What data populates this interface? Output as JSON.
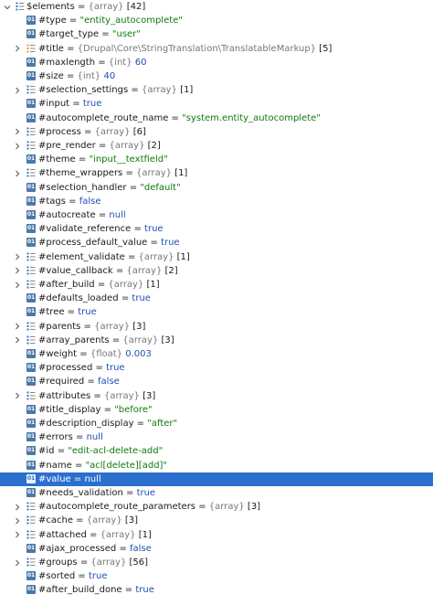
{
  "colors": {
    "selected_bg": "#2b6fcf",
    "string": "#117a0d",
    "keyword": "#1f4fb3",
    "type": "#777777"
  },
  "root": {
    "label": "$elements",
    "type": "{array}",
    "count": "[42]",
    "expanded": true
  },
  "rows": [
    {
      "kind": "prop",
      "key": "#type",
      "eq": " = ",
      "value": "\"entity_autocomplete\"",
      "vclass": "str"
    },
    {
      "kind": "prop",
      "key": "#target_type",
      "eq": " = ",
      "value": "\"user\"",
      "vclass": "str"
    },
    {
      "kind": "array",
      "key": "#title",
      "eq": " = ",
      "type": "{Drupal\\Core\\StringTranslation\\TranslatableMarkup}",
      "count": "[5]"
    },
    {
      "kind": "prop",
      "key": "#maxlength",
      "eq": " = ",
      "type": "{int}",
      "value": "60",
      "vclass": "num"
    },
    {
      "kind": "prop",
      "key": "#size",
      "eq": " = ",
      "type": "{int}",
      "value": "40",
      "vclass": "num"
    },
    {
      "kind": "array",
      "key": "#selection_settings",
      "eq": " = ",
      "type": "{array}",
      "count": "[1]"
    },
    {
      "kind": "prop",
      "key": "#input",
      "eq": " = ",
      "value": "true",
      "vclass": "kw"
    },
    {
      "kind": "prop",
      "key": "#autocomplete_route_name",
      "eq": " = ",
      "value": "\"system.entity_autocomplete\"",
      "vclass": "str"
    },
    {
      "kind": "array",
      "key": "#process",
      "eq": " = ",
      "type": "{array}",
      "count": "[6]"
    },
    {
      "kind": "array",
      "key": "#pre_render",
      "eq": " = ",
      "type": "{array}",
      "count": "[2]"
    },
    {
      "kind": "prop",
      "key": "#theme",
      "eq": " = ",
      "value": "\"input__textfield\"",
      "vclass": "str"
    },
    {
      "kind": "array",
      "key": "#theme_wrappers",
      "eq": " = ",
      "type": "{array}",
      "count": "[1]"
    },
    {
      "kind": "prop",
      "key": "#selection_handler",
      "eq": " = ",
      "value": "\"default\"",
      "vclass": "str"
    },
    {
      "kind": "prop",
      "key": "#tags",
      "eq": " = ",
      "value": "false",
      "vclass": "kw"
    },
    {
      "kind": "prop",
      "key": "#autocreate",
      "eq": " = ",
      "value": "null",
      "vclass": "kw"
    },
    {
      "kind": "prop",
      "key": "#validate_reference",
      "eq": " = ",
      "value": "true",
      "vclass": "kw"
    },
    {
      "kind": "prop",
      "key": "#process_default_value",
      "eq": " = ",
      "value": "true",
      "vclass": "kw"
    },
    {
      "kind": "array",
      "key": "#element_validate",
      "eq": " = ",
      "type": "{array}",
      "count": "[1]"
    },
    {
      "kind": "array",
      "key": "#value_callback",
      "eq": " = ",
      "type": "{array}",
      "count": "[2]"
    },
    {
      "kind": "array",
      "key": "#after_build",
      "eq": " = ",
      "type": "{array}",
      "count": "[1]"
    },
    {
      "kind": "prop",
      "key": "#defaults_loaded",
      "eq": " = ",
      "value": "true",
      "vclass": "kw"
    },
    {
      "kind": "prop",
      "key": "#tree",
      "eq": " = ",
      "value": "true",
      "vclass": "kw"
    },
    {
      "kind": "array",
      "key": "#parents",
      "eq": " = ",
      "type": "{array}",
      "count": "[3]"
    },
    {
      "kind": "array",
      "key": "#array_parents",
      "eq": " = ",
      "type": "{array}",
      "count": "[3]"
    },
    {
      "kind": "prop",
      "key": "#weight",
      "eq": " = ",
      "type": "{float}",
      "value": "0.003",
      "vclass": "num"
    },
    {
      "kind": "prop",
      "key": "#processed",
      "eq": " = ",
      "value": "true",
      "vclass": "kw"
    },
    {
      "kind": "prop",
      "key": "#required",
      "eq": " = ",
      "value": "false",
      "vclass": "kw"
    },
    {
      "kind": "array",
      "key": "#attributes",
      "eq": " = ",
      "type": "{array}",
      "count": "[3]"
    },
    {
      "kind": "prop",
      "key": "#title_display",
      "eq": " = ",
      "value": "\"before\"",
      "vclass": "str"
    },
    {
      "kind": "prop",
      "key": "#description_display",
      "eq": " = ",
      "value": "\"after\"",
      "vclass": "str"
    },
    {
      "kind": "prop",
      "key": "#errors",
      "eq": " = ",
      "value": "null",
      "vclass": "kw"
    },
    {
      "kind": "prop",
      "key": "#id",
      "eq": " = ",
      "value": "\"edit-acl-delete-add\"",
      "vclass": "str"
    },
    {
      "kind": "prop",
      "key": "#name",
      "eq": " = ",
      "value": "\"acl[delete][add]\"",
      "vclass": "str"
    },
    {
      "kind": "prop",
      "key": "#value",
      "eq": " = ",
      "value": "null",
      "vclass": "kw",
      "selected": true
    },
    {
      "kind": "prop",
      "key": "#needs_validation",
      "eq": " = ",
      "value": "true",
      "vclass": "kw"
    },
    {
      "kind": "array",
      "key": "#autocomplete_route_parameters",
      "eq": " = ",
      "type": "{array}",
      "count": "[3]"
    },
    {
      "kind": "array",
      "key": "#cache",
      "eq": " = ",
      "type": "{array}",
      "count": "[3]"
    },
    {
      "kind": "array",
      "key": "#attached",
      "eq": " = ",
      "type": "{array}",
      "count": "[1]"
    },
    {
      "kind": "prop",
      "key": "#ajax_processed",
      "eq": " = ",
      "value": "false",
      "vclass": "kw"
    },
    {
      "kind": "array",
      "key": "#groups",
      "eq": " = ",
      "type": "{array}",
      "count": "[56]"
    },
    {
      "kind": "prop",
      "key": "#sorted",
      "eq": " = ",
      "value": "true",
      "vclass": "kw"
    },
    {
      "kind": "prop",
      "key": "#after_build_done",
      "eq": " = ",
      "value": "true",
      "vclass": "kw"
    }
  ]
}
